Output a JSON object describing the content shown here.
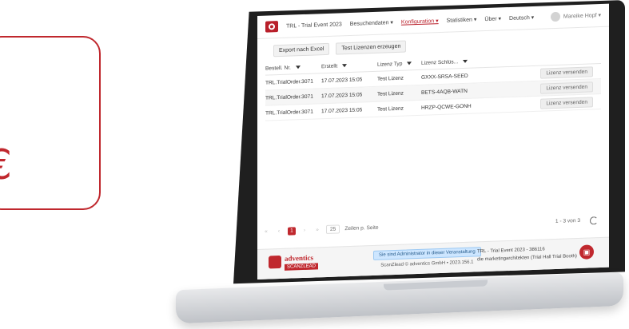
{
  "euro_symbol": "€",
  "nav": {
    "event": "TRL - Trial Event 2023",
    "items": [
      {
        "label": "Besuchendaten ▾",
        "active": false
      },
      {
        "label": "Konfiguration ▾",
        "active": true
      },
      {
        "label": "Statistiken ▾",
        "active": false
      },
      {
        "label": "Über ▾",
        "active": false
      },
      {
        "label": "Deutsch ▾",
        "active": false
      }
    ],
    "user": "Mareike Hopf ▾"
  },
  "toolbar": {
    "export_label": "Export nach Excel",
    "test_label": "Test Lizenzen erzeugen"
  },
  "table": {
    "headers": [
      "Bestell. Nr.",
      "Erstellt",
      "Lizenz Typ",
      "Lizenz Schlüs..."
    ],
    "rows": [
      {
        "order": "TRL.TrialOrder.3071",
        "created": "17.07.2023 15:05",
        "type": "Test Lizenz",
        "key": "GXXX-SRSA-SEED",
        "action": "Lizenz versenden"
      },
      {
        "order": "TRL.TrialOrder.3071",
        "created": "17.07.2023 15:05",
        "type": "Test Lizenz",
        "key": "BETS-4AQB-WATN",
        "action": "Lizenz versenden"
      },
      {
        "order": "TRL.TrialOrder.3071",
        "created": "17.07.2023 15:05",
        "type": "Test Lizenz",
        "key": "HRZP-QCWE-GONH",
        "action": "Lizenz versenden"
      }
    ]
  },
  "pager": {
    "current": "1",
    "page_size": "25",
    "page_size_label": "Zeilen p. Seite",
    "count": "1 - 3 von 3"
  },
  "footer": {
    "brand": "adventics",
    "brand_sub": "SCANZLEAD",
    "notice": "Sie sind Administrator in dieser Veranstaltung",
    "copyright": "ScanZlead © adventics GmbH • 2023.156.1",
    "event_line": "TRL - Trial Event 2023 - 386116",
    "org_line": "die marketingarchitekten (Trial Hall Trial Booth)"
  }
}
